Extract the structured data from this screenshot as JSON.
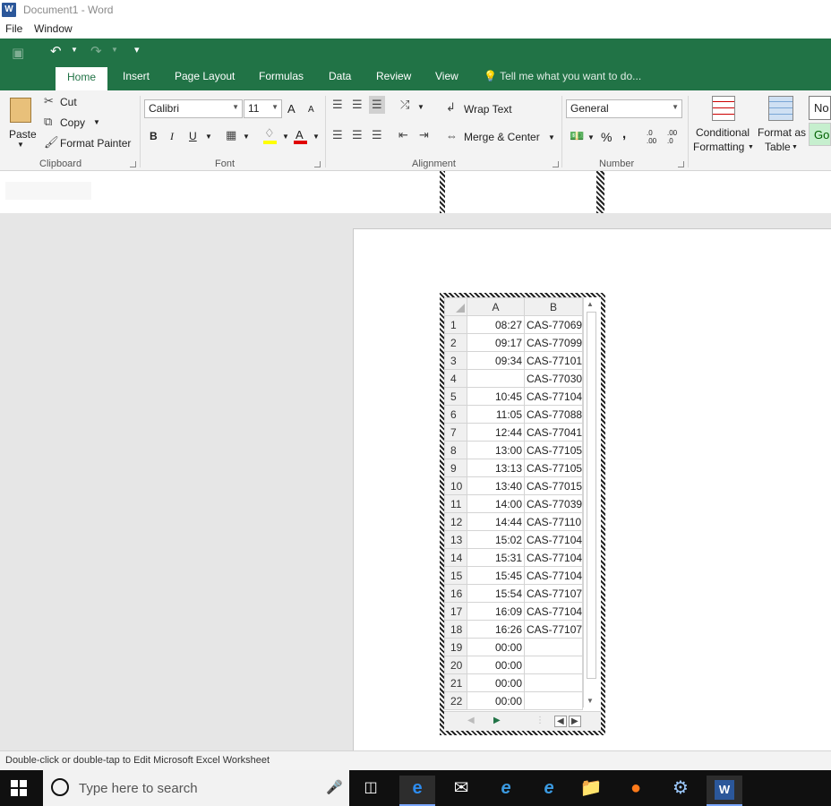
{
  "window": {
    "title": "Document1 - Word",
    "app_icon_letter": "W"
  },
  "menu": {
    "items": [
      "File",
      "Window"
    ]
  },
  "ribbon_tabs": [
    "Home",
    "Insert",
    "Page Layout",
    "Formulas",
    "Data",
    "Review",
    "View"
  ],
  "tell_me": "Tell me what you want to do...",
  "clipboard": {
    "paste": "Paste",
    "cut": "Cut",
    "copy": "Copy",
    "format_painter": "Format Painter",
    "label": "Clipboard"
  },
  "font": {
    "name": "Calibri",
    "size": "11",
    "bold": "B",
    "italic": "I",
    "underline": "U",
    "label": "Font",
    "grow": "A",
    "shrink": "A",
    "font_color": "A"
  },
  "alignment": {
    "wrap_text": "Wrap Text",
    "merge_center": "Merge & Center",
    "label": "Alignment"
  },
  "number": {
    "format": "General",
    "percent": "%",
    "comma": ",",
    "inc_decimal": ".0 .00",
    "dec_decimal": ".00 .0",
    "label": "Number"
  },
  "styles": {
    "conditional_formatting_1": "Conditional",
    "conditional_formatting_2": "Formatting",
    "format_as_table_1": "Format as",
    "format_as_table_2": "Table",
    "style_normal": "No",
    "style_good": "Go"
  },
  "worksheet": {
    "col_a": "A",
    "col_b": "B",
    "rows": [
      {
        "n": "1",
        "a": "08:27",
        "b": "CAS-77069"
      },
      {
        "n": "2",
        "a": "09:17",
        "b": "CAS-77099"
      },
      {
        "n": "3",
        "a": "09:34",
        "b": "CAS-77101"
      },
      {
        "n": "4",
        "a": "",
        "b": "CAS-77030"
      },
      {
        "n": "5",
        "a": "10:45",
        "b": "CAS-77104"
      },
      {
        "n": "6",
        "a": "11:05",
        "b": "CAS-77088"
      },
      {
        "n": "7",
        "a": "12:44",
        "b": "CAS-77041"
      },
      {
        "n": "8",
        "a": "13:00",
        "b": "CAS-77105"
      },
      {
        "n": "9",
        "a": "13:13",
        "b": "CAS-77105"
      },
      {
        "n": "10",
        "a": "13:40",
        "b": "CAS-77015"
      },
      {
        "n": "11",
        "a": "14:00",
        "b": "CAS-77039"
      },
      {
        "n": "12",
        "a": "14:44",
        "b": "CAS-77110"
      },
      {
        "n": "13",
        "a": "15:02",
        "b": "CAS-77104"
      },
      {
        "n": "14",
        "a": "15:31",
        "b": "CAS-77104"
      },
      {
        "n": "15",
        "a": "15:45",
        "b": "CAS-77104"
      },
      {
        "n": "16",
        "a": "15:54",
        "b": "CAS-77107"
      },
      {
        "n": "17",
        "a": "16:09",
        "b": "CAS-77104"
      },
      {
        "n": "18",
        "a": "16:26",
        "b": "CAS-77107"
      },
      {
        "n": "19",
        "a": "00:00",
        "b": ""
      },
      {
        "n": "20",
        "a": "00:00",
        "b": ""
      },
      {
        "n": "21",
        "a": "00:00",
        "b": ""
      },
      {
        "n": "22",
        "a": "00:00",
        "b": ""
      }
    ]
  },
  "status": {
    "text": "Double-click or double-tap to Edit Microsoft Excel Worksheet"
  },
  "taskbar": {
    "search_placeholder": "Type here to search"
  },
  "colors": {
    "excel_green": "#217346",
    "word_blue": "#2b579a"
  }
}
